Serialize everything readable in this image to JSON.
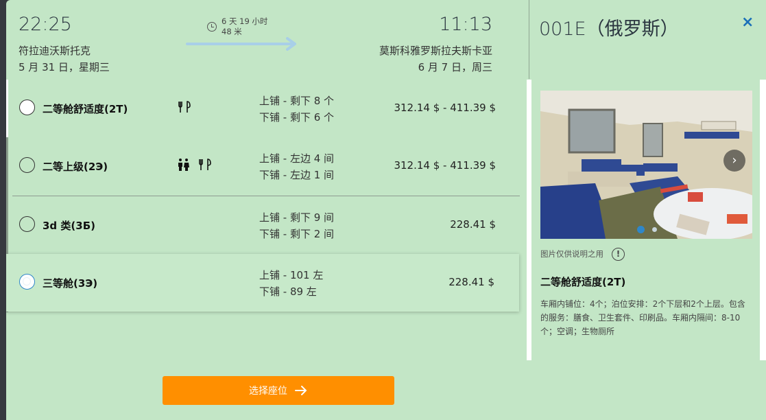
{
  "departure": {
    "time": "22:25",
    "city": "符拉迪沃斯托克",
    "date": "5 月 31 日，星期三"
  },
  "arrival": {
    "time": "11:13",
    "city": "莫斯科雅罗斯拉夫斯卡亚",
    "date": "6 月 7 日，周三"
  },
  "duration": {
    "line1": "6 天 19 小时",
    "line2": "48 米"
  },
  "fares": [
    {
      "class": "二等舱舒适度(2T)",
      "amenities": "Ψ٩",
      "berth_upper": "上铺 - 剩下 8 个",
      "berth_lower": "下铺 - 剩下 6 个",
      "price": "312.14 $ - 411.39 $",
      "selected": false
    },
    {
      "class": "二等上级(2Э)",
      "amenities": "👫 Ψ٩",
      "berth_upper": "上铺 - 左边 4 间",
      "berth_lower": "下铺 - 左边 1 间",
      "price": "312.14 $ - 411.39 $",
      "selected": false
    },
    {
      "class": "3d 类(3Б)",
      "amenities": "",
      "berth_upper": "上铺 - 剩下 9 间",
      "berth_lower": "下铺 - 剩下 2 间",
      "price": "228.41 $",
      "selected": false
    },
    {
      "class": "三等舱(3Э)",
      "amenities": "",
      "berth_upper": "上铺 - 101 左",
      "berth_lower": "下铺 - 89 左",
      "price": "228.41 $",
      "selected": true
    }
  ],
  "cta": {
    "label": "选择座位"
  },
  "panel": {
    "car_title": "001E（俄罗斯）",
    "close": "×",
    "photo_note": "图片仅供说明之用",
    "info": "!",
    "car_class": "二等舱舒适度(2T)",
    "description": "车厢内铺位：4个；泊位安排：2个下层和2个上层。包含的服务：膳食、卫生套件、印刷品。车厢内隔间：8-10个；空调；生物厕所"
  },
  "colors": {
    "background": "#c3e6c6",
    "accent": "#ff8f00",
    "link": "#1a6fb8"
  },
  "icons": [
    "clock-icon",
    "arrow-right-icon",
    "cutlery-icon",
    "toilet-icon",
    "chevron-right-icon",
    "info-icon",
    "close-icon"
  ]
}
